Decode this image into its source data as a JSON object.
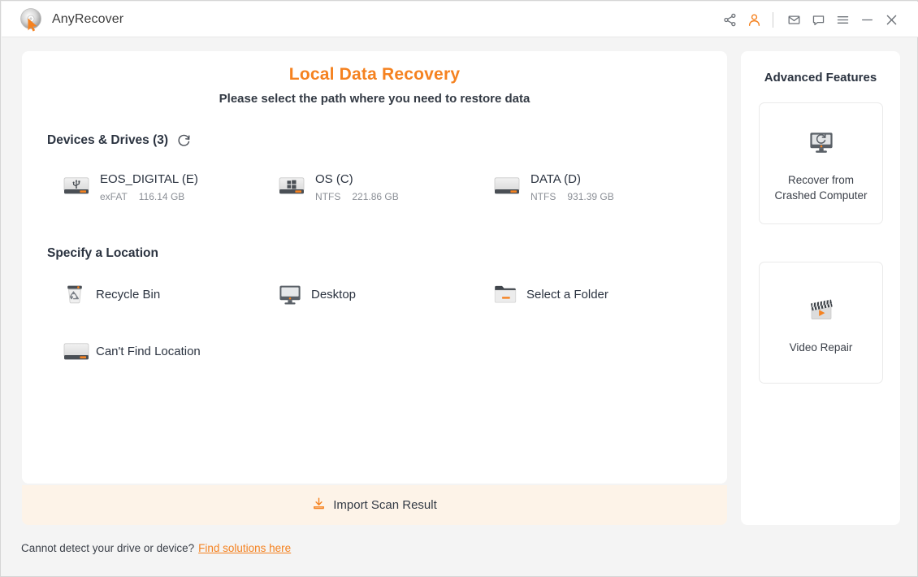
{
  "window": {
    "app_title": "AnyRecover",
    "logo_icon": "disc-cursor-logo",
    "titlebar_icons": [
      {
        "name": "share-icon",
        "glyph": "share"
      },
      {
        "name": "account-icon",
        "glyph": "person",
        "color": "#f58220"
      },
      {
        "name": "mail-icon",
        "glyph": "envelope"
      },
      {
        "name": "feedback-icon",
        "glyph": "chat-bubble"
      },
      {
        "name": "menu-icon",
        "glyph": "hamburger"
      },
      {
        "name": "minimize-icon",
        "glyph": "minus"
      },
      {
        "name": "close-icon",
        "glyph": "x"
      }
    ]
  },
  "main": {
    "title": "Local Data Recovery",
    "subtitle": "Please select the path where you need to restore data",
    "devices_section": {
      "heading": "Devices & Drives (3)",
      "refresh_icon": "refresh-icon",
      "drives": [
        {
          "name": "EOS_DIGITAL (E)",
          "filesystem": "exFAT",
          "size": "116.14 GB",
          "icon": "usb-drive-icon"
        },
        {
          "name": "OS (C)",
          "filesystem": "NTFS",
          "size": "221.86 GB",
          "icon": "windows-drive-icon"
        },
        {
          "name": "DATA (D)",
          "filesystem": "NTFS",
          "size": "931.39 GB",
          "icon": "hard-drive-icon"
        }
      ]
    },
    "location_section": {
      "heading": "Specify a Location",
      "locations": [
        {
          "label": "Recycle Bin",
          "icon": "recycle-bin-icon"
        },
        {
          "label": "Desktop",
          "icon": "desktop-monitor-icon"
        },
        {
          "label": "Select a Folder",
          "icon": "folder-icon"
        },
        {
          "label": "Can't Find Location",
          "icon": "hard-drive-icon"
        }
      ]
    },
    "import_bar": {
      "label": "Import Scan Result",
      "icon": "download-icon"
    }
  },
  "side_panel": {
    "title": "Advanced Features",
    "features": [
      {
        "label": "Recover from\nCrashed Computer",
        "line1": "Recover from",
        "line2": "Crashed Computer",
        "icon": "crashed-computer-icon"
      },
      {
        "label": "Video Repair",
        "line1": "Video Repair",
        "line2": "",
        "icon": "video-clapper-icon"
      }
    ]
  },
  "footer": {
    "text": "Cannot detect your drive or device?",
    "link": "Find solutions here"
  },
  "colors": {
    "accent": "#f58220",
    "page_bg": "#f4f4f4",
    "card_bg": "#ffffff",
    "import_bg": "#fdf3e8",
    "text": "#2b3340",
    "muted": "#8b8f96"
  }
}
